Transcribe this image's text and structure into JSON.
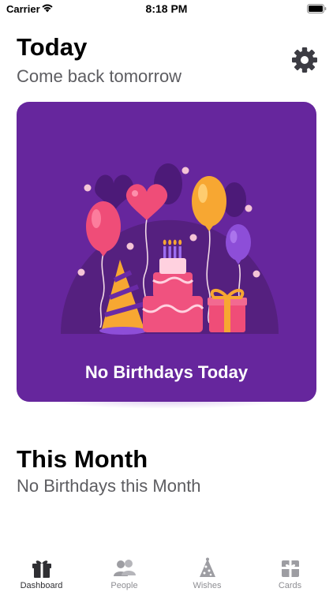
{
  "status_bar": {
    "carrier": "Carrier",
    "time": "8:18 PM"
  },
  "today": {
    "title": "Today",
    "subtitle": "Come back tomorrow",
    "card_caption": "No Birthdays Today"
  },
  "this_month": {
    "title": "This Month",
    "subtitle": "No Birthdays this Month"
  },
  "tab_bar": {
    "tabs": [
      {
        "label": "Dashboard",
        "icon": "gift-icon",
        "active": true
      },
      {
        "label": "People",
        "icon": "people-icon",
        "active": false
      },
      {
        "label": "Wishes",
        "icon": "party-hat-icon",
        "active": false
      },
      {
        "label": "Cards",
        "icon": "gift-card-icon",
        "active": false
      }
    ]
  },
  "colors": {
    "card_background": "#66269d",
    "tab_active": "#2f2f33",
    "tab_inactive": "#8e8e93",
    "subtitle": "#5d5d61"
  }
}
